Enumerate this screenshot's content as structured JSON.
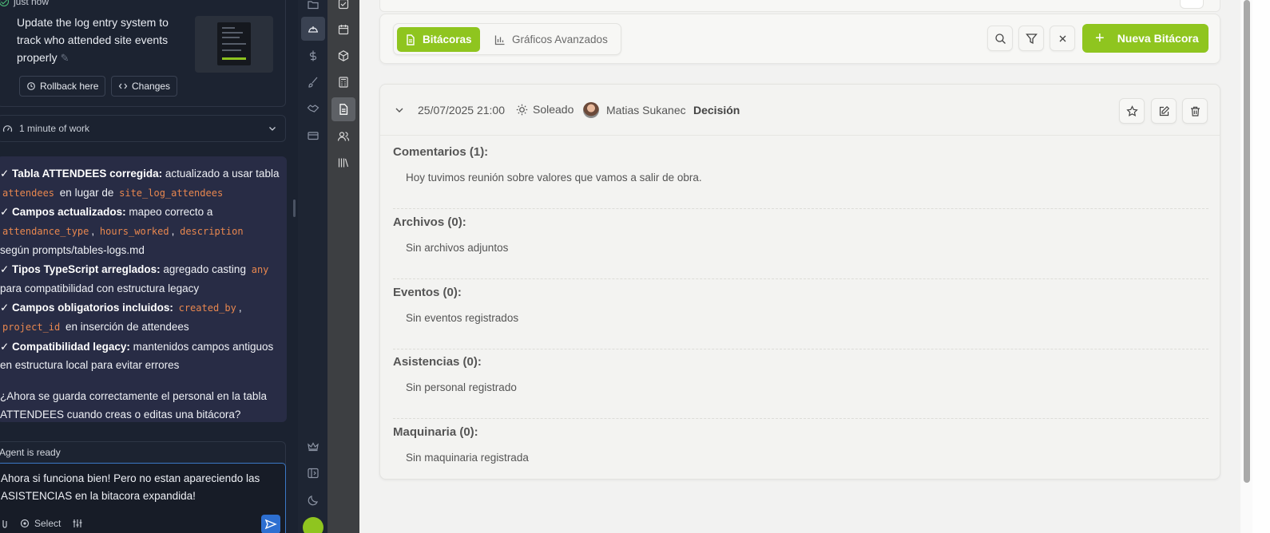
{
  "agent_panel": {
    "checkpoint": {
      "time": "just now",
      "message": "Update the log entry system to track who attended site events properly",
      "rollback_label": "Rollback here",
      "changes_label": "Changes"
    },
    "work_duration": "1 minute of work",
    "summary": {
      "item1_bold": "✓ Tabla ATTENDEES corregida:",
      "item1_text": "actualizado a usar tabla",
      "item1_code1": "attendees",
      "item1_mid": "en lugar de",
      "item1_code2": "site_log_attendees",
      "item2_bold": "✓ Campos actualizados:",
      "item2_text": "mapeo correcto a",
      "item2_code1": "attendance_type",
      "item2_code2": "hours_worked",
      "item2_code3": "description",
      "item2_tail": "según prompts/tables-logs.md",
      "item3_bold": "✓ Tipos TypeScript arreglados:",
      "item3_text": "agregado casting",
      "item3_code": "any",
      "item3_tail": "para compatibilidad con estructura legacy",
      "item4_bold": "✓ Campos obligatorios incluidos:",
      "item4_code1": "created_by",
      "item4_code2": "project_id",
      "item4_tail": "en inserción de attendees",
      "item5_bold": "✓ Compatibilidad legacy:",
      "item5_text": "mantenidos campos antiguos en estructura local para evitar errores",
      "question": "¿Ahora se guarda correctamente el personal en la tabla ATTENDEES cuando creas o editas una bitácora?"
    },
    "composer": {
      "status": "Agent is ready",
      "input_value": "Ahora si funciona bien! Pero  no estan apareciendo las ASISTENCIAS en la bitacora expandida!",
      "select_label": "Select"
    }
  },
  "toolbar": {
    "tab_active": "Bitácoras",
    "tab_inactive": "Gráficos Avanzados",
    "new_button": "Nueva Bitácora"
  },
  "entry": {
    "date": "25/07/2025 21:00",
    "weather": "Soleado",
    "user": "Matias Sukanec",
    "type": "Decisión",
    "sections": [
      {
        "title": "Comentarios (1):",
        "body": "Hoy tuvimos reunión sobre valores que vamos a salir de obra."
      },
      {
        "title": "Archivos (0):",
        "body": "Sin archivos adjuntos"
      },
      {
        "title": "Eventos (0):",
        "body": "Sin eventos registrados"
      },
      {
        "title": "Asistencias (0):",
        "body": "Sin personal registrado"
      },
      {
        "title": "Maquinaria (0):",
        "body": "Sin maquinaria registrada"
      }
    ]
  },
  "colors": {
    "accent": "#8fc51f",
    "agent_bg": "#1b2230",
    "summary_bg": "#282c45",
    "code": "#e8874f"
  }
}
